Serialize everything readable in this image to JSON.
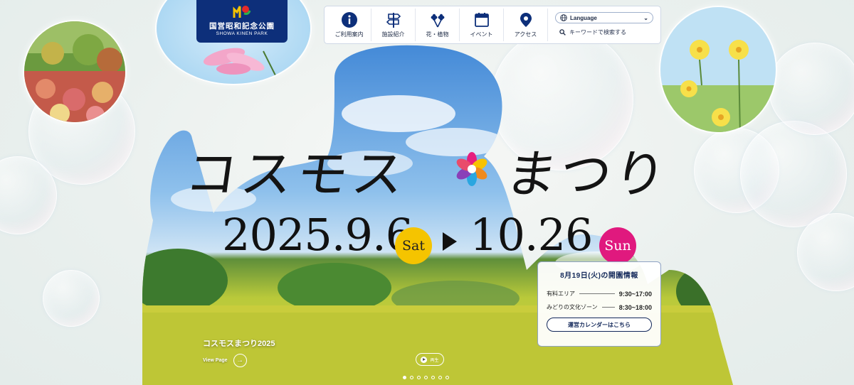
{
  "logo": {
    "name_jp": "国営昭和記念公園",
    "name_en": "SHOWA KINEN PARK"
  },
  "nav": {
    "items": [
      {
        "label": "ご利用案内",
        "icon": "info-icon"
      },
      {
        "label": "施設紹介",
        "icon": "signpost-icon"
      },
      {
        "label": "花・植物",
        "icon": "flowers-icon"
      },
      {
        "label": "イベント",
        "icon": "calendar-icon"
      },
      {
        "label": "アクセス",
        "icon": "map-pin-icon"
      }
    ],
    "language_label": "Language",
    "search_placeholder": "キーワードで検索する"
  },
  "hero": {
    "title_left": "コスモス",
    "title_right": "まつり",
    "start_date": "2025.9.6",
    "start_day": "Sat",
    "end_date": "10.26",
    "end_day": "Sun",
    "event_name": "コスモスまつり2025",
    "view_page": "View Page",
    "play_label": "再生",
    "slide_count": 7,
    "active_slide": 1
  },
  "info": {
    "title": "8月19日(火)の開園情報",
    "rows": [
      {
        "label": "有料エリア",
        "time": "9:30~17:00"
      },
      {
        "label": "みどりの文化ゾーン",
        "time": "8:30~18:00"
      }
    ],
    "button": "運営カレンダーはこちら"
  },
  "colors": {
    "navy": "#0d2f7a",
    "sat_badge": "#f5c400",
    "sun_badge": "#e0197e"
  }
}
